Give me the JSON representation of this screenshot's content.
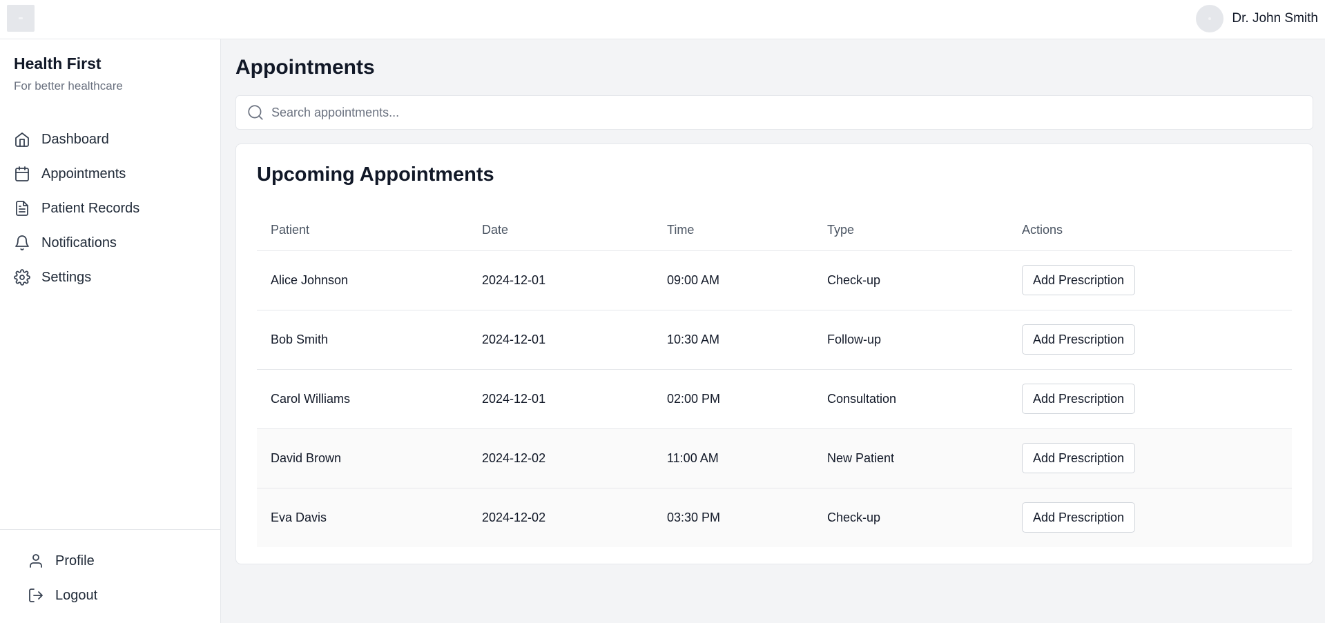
{
  "header": {
    "user_name": "Dr. John Smith"
  },
  "sidebar": {
    "brand_title": "Health First",
    "brand_subtitle": "For better healthcare",
    "items": [
      {
        "label": "Dashboard",
        "icon": "home-icon"
      },
      {
        "label": "Appointments",
        "icon": "calendar-icon"
      },
      {
        "label": "Patient Records",
        "icon": "file-text-icon"
      },
      {
        "label": "Notifications",
        "icon": "bell-icon"
      },
      {
        "label": "Settings",
        "icon": "gear-icon"
      }
    ],
    "bottom_items": [
      {
        "label": "Profile",
        "icon": "user-icon"
      },
      {
        "label": "Logout",
        "icon": "logout-icon"
      }
    ]
  },
  "main": {
    "page_title": "Appointments",
    "search": {
      "placeholder": "Search appointments...",
      "value": ""
    },
    "card_title": "Upcoming Appointments",
    "table": {
      "headers": [
        "Patient",
        "Date",
        "Time",
        "Type",
        "Actions"
      ],
      "rows": [
        {
          "patient": "Alice Johnson",
          "date": "2024-12-01",
          "time": "09:00 AM",
          "type": "Check-up",
          "action": "Add Prescription"
        },
        {
          "patient": "Bob Smith",
          "date": "2024-12-01",
          "time": "10:30 AM",
          "type": "Follow-up",
          "action": "Add Prescription"
        },
        {
          "patient": "Carol Williams",
          "date": "2024-12-01",
          "time": "02:00 PM",
          "type": "Consultation",
          "action": "Add Prescription"
        },
        {
          "patient": "David Brown",
          "date": "2024-12-02",
          "time": "11:00 AM",
          "type": "New Patient",
          "action": "Add Prescription"
        },
        {
          "patient": "Eva Davis",
          "date": "2024-12-02",
          "time": "03:30 PM",
          "type": "Check-up",
          "action": "Add Prescription"
        }
      ]
    }
  },
  "colors": {
    "background": "#f3f4f6",
    "surface": "#ffffff",
    "border": "#e5e7eb",
    "text": "#111827",
    "muted_text": "#6b7280"
  }
}
